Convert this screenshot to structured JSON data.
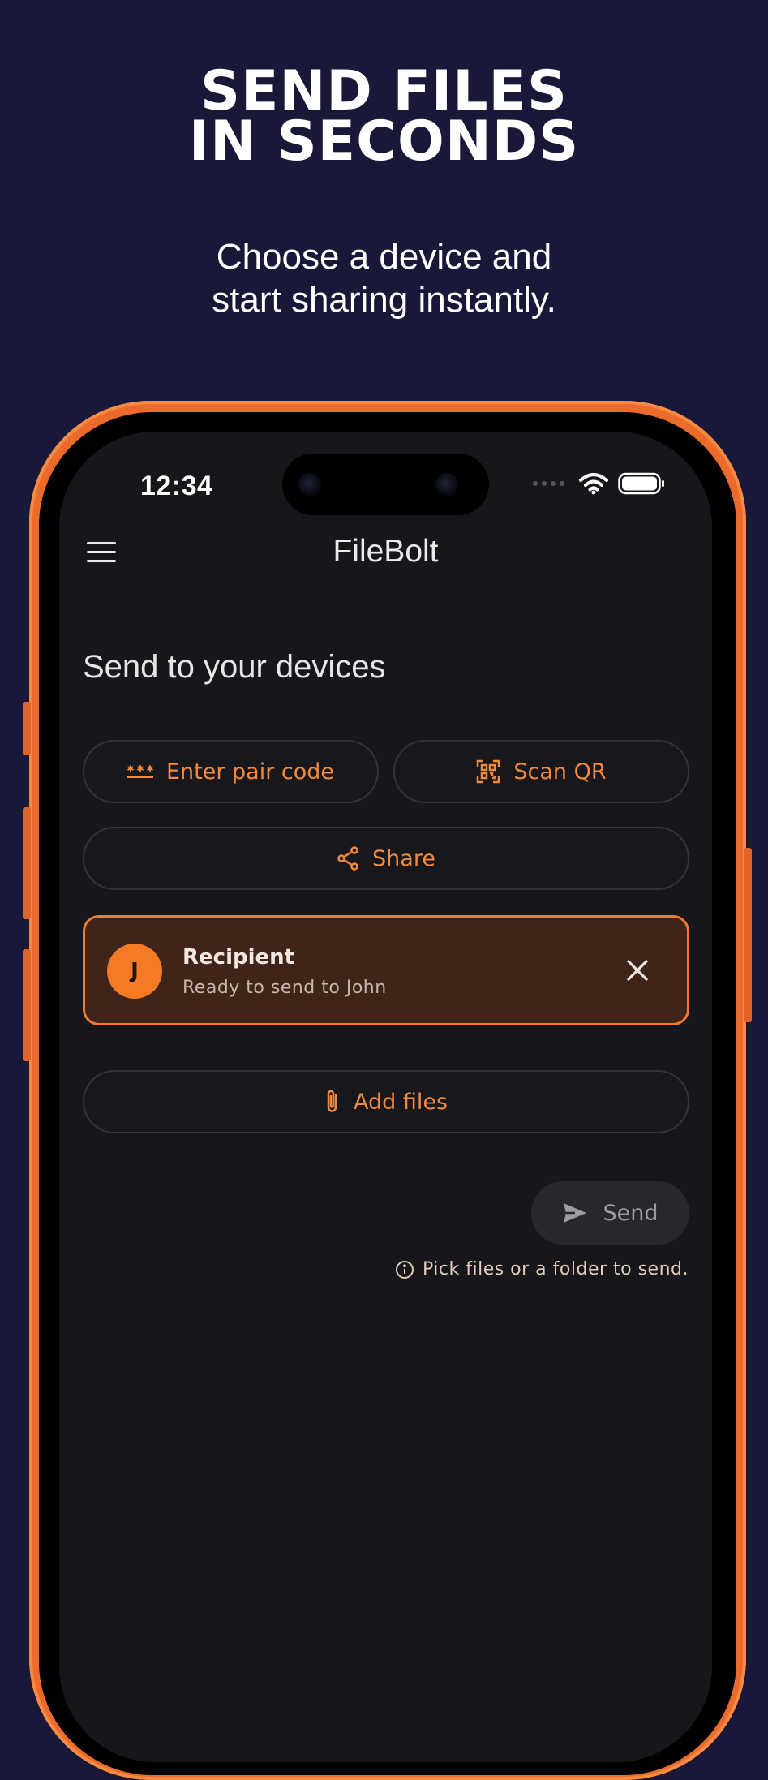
{
  "hero": {
    "headline_line1": "SEND FILES",
    "headline_line2": "IN SECONDS",
    "subhead_line1": "Choose a device and",
    "subhead_line2": "start sharing instantly."
  },
  "status_bar": {
    "time": "12:34"
  },
  "app_bar": {
    "title": "FileBolt",
    "menu_icon": "hamburger-menu-icon"
  },
  "main": {
    "section_title": "Send to your devices",
    "actions": {
      "pair_code_label": "Enter pair code",
      "scan_qr_label": "Scan QR",
      "share_label": "Share"
    },
    "recipient": {
      "initial": "J",
      "title": "Recipient",
      "subtitle": "Ready to send to John"
    },
    "add_files_label": "Add files",
    "send_label": "Send",
    "hint": "Pick files or a folder to send."
  },
  "colors": {
    "accent": "#f08a3e",
    "background": "#1a1838",
    "screen": "#17161b",
    "frame": "#ec6a2a"
  }
}
